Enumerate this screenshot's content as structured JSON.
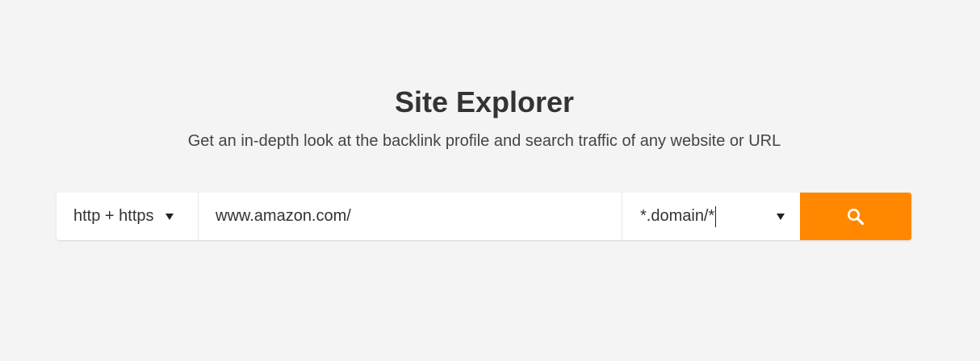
{
  "header": {
    "title": "Site Explorer",
    "subtitle": "Get an in-depth look at the backlink profile and search traffic of any website or URL"
  },
  "search": {
    "protocol": {
      "selected": "http + https",
      "icon": "caret-down-icon"
    },
    "url": {
      "value": "www.amazon.com/"
    },
    "mode": {
      "selected": "*.domain/*",
      "icon": "caret-down-icon"
    },
    "button": {
      "icon": "search-icon",
      "color": "#ff8800"
    }
  },
  "colors": {
    "background": "#f4f4f4",
    "accent": "#ff8800",
    "text": "#333333"
  }
}
